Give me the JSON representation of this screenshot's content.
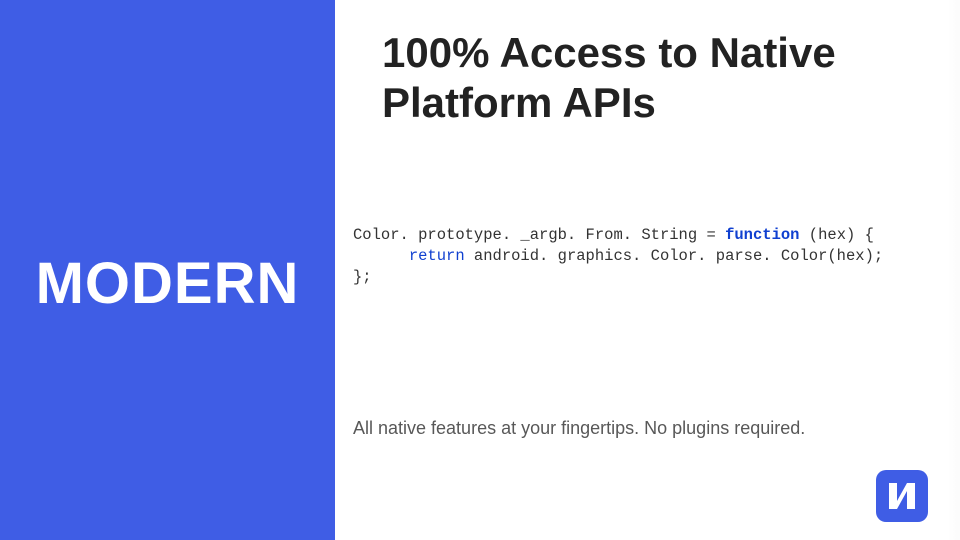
{
  "sidebar": {
    "label": "MODERN"
  },
  "main": {
    "title": "100% Access to Native Platform APIs",
    "code": {
      "line1_part1": "Color. prototype. _argb. From. String = ",
      "line1_kw": "function",
      "line1_part2": " (hex) {",
      "line2_indent": "      ",
      "line2_kw": "return",
      "line2_rest": " android. graphics. Color. parse. Color(hex);",
      "line3": "};"
    },
    "body": "All native features at your fingertips.  No plugins required."
  },
  "logo": {
    "name": "nativescript-logo"
  },
  "colors": {
    "accent": "#3f5de5"
  }
}
